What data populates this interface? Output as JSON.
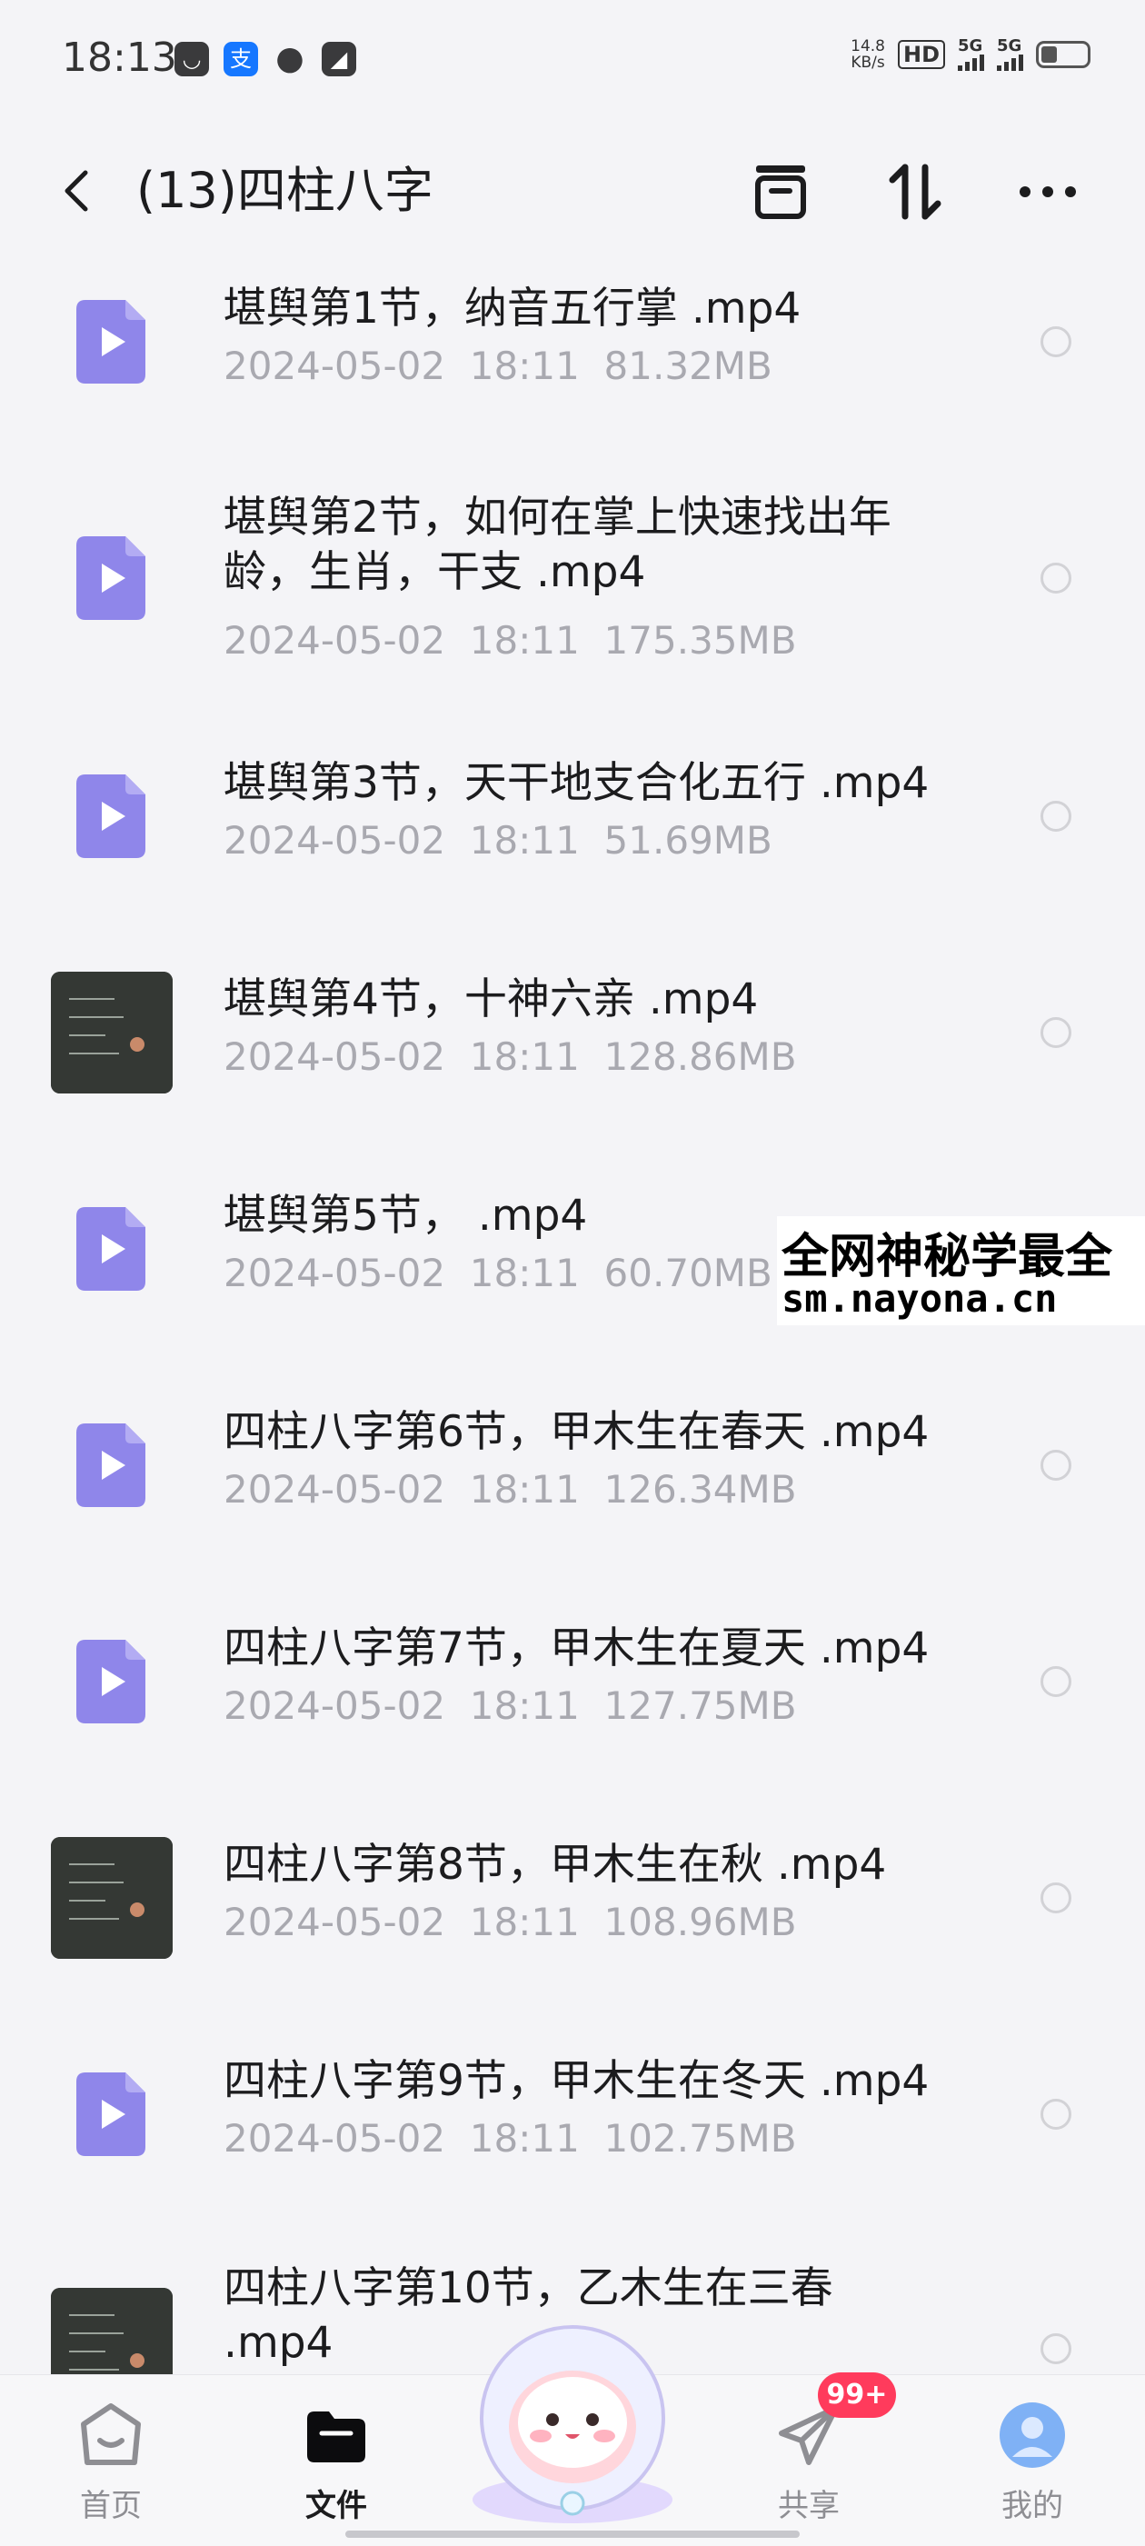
{
  "status_bar": {
    "time": "18:13",
    "net_speed_value": "14.8",
    "net_speed_unit": "KB/s",
    "hd_label": "HD",
    "sim1_label": "5G",
    "sim2_label": "5G",
    "battery_level": 0.35,
    "app_icons": [
      "notification-icon",
      "alipay-icon",
      "message-icon",
      "notification-icon"
    ]
  },
  "header": {
    "title": "(13)四柱八字"
  },
  "files": [
    {
      "name": "堪舆第1节，纳音五行掌 .mp4",
      "date": "2024-05-02",
      "time": "18:11",
      "size": "81.32MB",
      "thumb": "video"
    },
    {
      "name": "堪舆第2节，如何在掌上快速找出年龄，生肖，干支 .mp4",
      "date": "2024-05-02",
      "time": "18:11",
      "size": "175.35MB",
      "thumb": "video"
    },
    {
      "name": "堪舆第3节，天干地支合化五行 .mp4",
      "date": "2024-05-02",
      "time": "18:11",
      "size": "51.69MB",
      "thumb": "video"
    },
    {
      "name": "堪舆第4节，十神六亲 .mp4",
      "date": "2024-05-02",
      "time": "18:11",
      "size": "128.86MB",
      "thumb": "photo"
    },
    {
      "name": "堪舆第5节，  .mp4",
      "date": "2024-05-02",
      "time": "18:11",
      "size": "60.70MB",
      "thumb": "video"
    },
    {
      "name": "四柱八字第6节，甲木生在春天 .mp4",
      "date": "2024-05-02",
      "time": "18:11",
      "size": "126.34MB",
      "thumb": "video"
    },
    {
      "name": "四柱八字第7节，甲木生在夏天 .mp4",
      "date": "2024-05-02",
      "time": "18:11",
      "size": "127.75MB",
      "thumb": "video"
    },
    {
      "name": "四柱八字第8节，甲木生在秋 .mp4",
      "date": "2024-05-02",
      "time": "18:11",
      "size": "108.96MB",
      "thumb": "photo"
    },
    {
      "name": "四柱八字第9节，甲木生在冬天 .mp4",
      "date": "2024-05-02",
      "time": "18:11",
      "size": "102.75MB",
      "thumb": "video"
    },
    {
      "name": "四柱八字第10节，乙木生在三春 .mp4",
      "date": "",
      "time": "",
      "size": "",
      "thumb": "photo"
    }
  ],
  "watermark": {
    "line1": "全网神秘学最全",
    "line2": "sm.nayona.cn"
  },
  "bottom_nav": {
    "home_label": "首页",
    "files_label": "文件",
    "share_label": "共享",
    "mine_label": "我的",
    "share_badge": "99+",
    "active": "files"
  },
  "colors": {
    "accent_purple": "#8f86ea",
    "badge_red": "#ff3b5c",
    "meta_gray": "#a9a9b0",
    "background": "#f4f4f7"
  }
}
